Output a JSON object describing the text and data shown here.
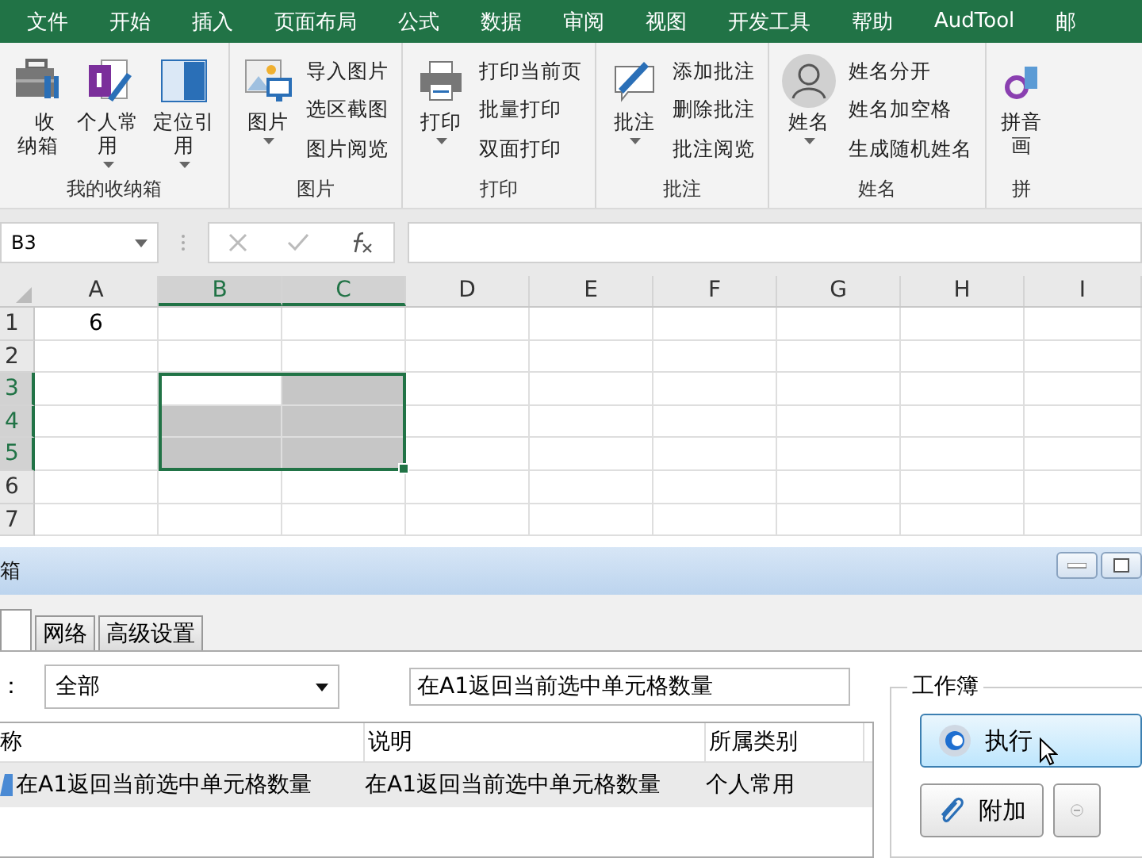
{
  "menu_tabs": [
    "文件",
    "开始",
    "插入",
    "页面布局",
    "公式",
    "数据",
    "审阅",
    "视图",
    "开发工具",
    "帮助",
    "AudTool",
    "邮"
  ],
  "ribbon": {
    "groups": [
      {
        "label": "我的收纳箱",
        "items": [
          {
            "kind": "large",
            "label": "收纳箱",
            "dropdown": false
          },
          {
            "kind": "large",
            "label": "个人常用",
            "dropdown": true
          },
          {
            "kind": "large",
            "label": "定位引用",
            "dropdown": true
          }
        ]
      },
      {
        "label": "图片",
        "items": [
          {
            "kind": "large",
            "label": "图片",
            "dropdown": true
          },
          {
            "kind": "stack",
            "entries": [
              "导入图片",
              "选区截图",
              "图片阅览"
            ]
          }
        ]
      },
      {
        "label": "打印",
        "items": [
          {
            "kind": "large",
            "label": "打印",
            "dropdown": true
          },
          {
            "kind": "stack",
            "entries": [
              "打印当前页",
              "批量打印",
              "双面打印"
            ]
          }
        ]
      },
      {
        "label": "批注",
        "items": [
          {
            "kind": "large",
            "label": "批注",
            "dropdown": true
          },
          {
            "kind": "stack",
            "entries": [
              "添加批注",
              "删除批注",
              "批注阅览"
            ]
          }
        ]
      },
      {
        "label": "姓名",
        "items": [
          {
            "kind": "large",
            "label": "姓名",
            "dropdown": true
          },
          {
            "kind": "stack",
            "entries": [
              "姓名分开",
              "姓名加空格",
              "生成随机姓名"
            ]
          }
        ]
      },
      {
        "label": "拼",
        "items": [
          {
            "kind": "large",
            "label": "拼音画",
            "dropdown": false
          }
        ]
      }
    ]
  },
  "formula_bar": {
    "name_box": "B3"
  },
  "sheet": {
    "columns": [
      {
        "label": "A",
        "selected": false
      },
      {
        "label": "B",
        "selected": true
      },
      {
        "label": "C",
        "selected": true
      },
      {
        "label": "D",
        "selected": false
      },
      {
        "label": "E",
        "selected": false
      },
      {
        "label": "F",
        "selected": false
      },
      {
        "label": "G",
        "selected": false
      },
      {
        "label": "H",
        "selected": false
      },
      {
        "label": "I",
        "selected": false
      }
    ],
    "rows": [
      {
        "label": "1",
        "selected": false,
        "cells": [
          {
            "value": "6",
            "selected": false
          },
          {
            "selected": false
          },
          {
            "selected": false
          },
          {
            "selected": false
          },
          {
            "selected": false
          },
          {
            "selected": false
          },
          {
            "selected": false
          },
          {
            "selected": false
          },
          {
            "selected": false
          }
        ]
      },
      {
        "label": "2",
        "selected": false,
        "cells": [
          {
            "selected": false
          },
          {
            "selected": false
          },
          {
            "selected": false
          },
          {
            "selected": false
          },
          {
            "selected": false
          },
          {
            "selected": false
          },
          {
            "selected": false
          },
          {
            "selected": false
          },
          {
            "selected": false
          }
        ]
      },
      {
        "label": "3",
        "selected": true,
        "cells": [
          {
            "selected": false
          },
          {
            "selected": false
          },
          {
            "selected": true
          },
          {
            "selected": false
          },
          {
            "selected": false
          },
          {
            "selected": false
          },
          {
            "selected": false
          },
          {
            "selected": false
          },
          {
            "selected": false
          }
        ]
      },
      {
        "label": "4",
        "selected": true,
        "cells": [
          {
            "selected": false
          },
          {
            "selected": true
          },
          {
            "selected": true
          },
          {
            "selected": false
          },
          {
            "selected": false
          },
          {
            "selected": false
          },
          {
            "selected": false
          },
          {
            "selected": false
          },
          {
            "selected": false
          }
        ]
      },
      {
        "label": "5",
        "selected": true,
        "cells": [
          {
            "selected": false
          },
          {
            "selected": true
          },
          {
            "selected": true
          },
          {
            "selected": false
          },
          {
            "selected": false
          },
          {
            "selected": false
          },
          {
            "selected": false
          },
          {
            "selected": false
          },
          {
            "selected": false
          }
        ]
      },
      {
        "label": "6",
        "selected": false,
        "cells": [
          {
            "selected": false
          },
          {
            "selected": false
          },
          {
            "selected": false
          },
          {
            "selected": false
          },
          {
            "selected": false
          },
          {
            "selected": false
          },
          {
            "selected": false
          },
          {
            "selected": false
          },
          {
            "selected": false
          }
        ]
      },
      {
        "label": "7",
        "selected": false,
        "cells": [
          {
            "selected": false
          },
          {
            "selected": false
          },
          {
            "selected": false
          },
          {
            "selected": false
          },
          {
            "selected": false
          },
          {
            "selected": false
          },
          {
            "selected": false
          },
          {
            "selected": false
          },
          {
            "selected": false
          }
        ]
      }
    ]
  },
  "dialog": {
    "title": "箱",
    "tabs": [
      {
        "selected": true
      },
      {
        "label": "网络",
        "selected": false
      },
      {
        "label": "高级设置",
        "selected": false
      }
    ],
    "category_label": "：",
    "category_value": "全部",
    "search_value": "在A1返回当前选中单元格数量",
    "table": {
      "columns": [
        "称",
        "说明",
        "所属类别"
      ],
      "rows": [
        {
          "cells": [
            "在A1返回当前选中单元格数量",
            "在A1返回当前选中单元格数量",
            "个人常用"
          ],
          "selected": true
        }
      ]
    },
    "workbook_group": {
      "label": "工作簿",
      "buttons": [
        {
          "label": "执行",
          "hovered": true
        },
        {
          "label": "附加",
          "hovered": false
        },
        {
          "hovered": false
        }
      ]
    }
  }
}
